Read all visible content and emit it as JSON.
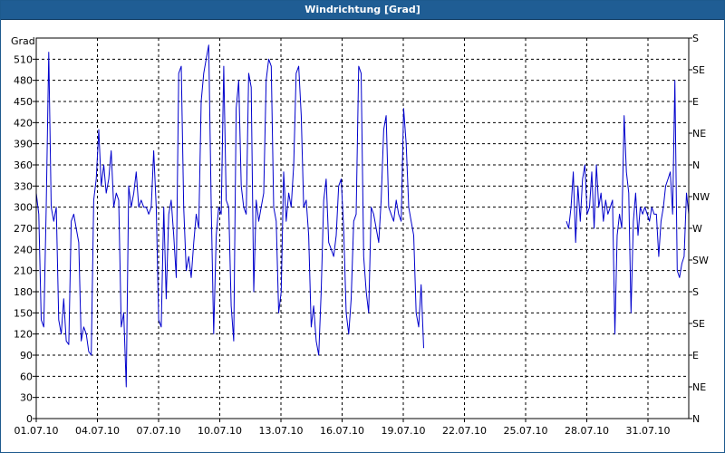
{
  "window": {
    "title": "Windrichtung [Grad]"
  },
  "colors": {
    "title_bar": "#1f5d94",
    "series": "#0000cc",
    "grid": "#000000"
  },
  "chart_data": {
    "type": "line",
    "title": "Windrichtung [Grad]",
    "ylabel": "Grad",
    "xlabel": "",
    "ylim": [
      0,
      540
    ],
    "xlim": [
      "2010-07-01",
      "2010-08-02"
    ],
    "y_ticks": [
      0,
      30,
      60,
      90,
      120,
      150,
      180,
      210,
      240,
      270,
      300,
      330,
      360,
      390,
      420,
      450,
      480,
      510
    ],
    "x_ticks": [
      "01.07.10",
      "04.07.10",
      "07.07.10",
      "10.07.10",
      "13.07.10",
      "16.07.10",
      "19.07.10",
      "22.07.10",
      "25.07.10",
      "28.07.10",
      "31.07.10"
    ],
    "right_axis": {
      "ticks": [
        0,
        45,
        90,
        135,
        180,
        225,
        270,
        315,
        360,
        405,
        450,
        495,
        540
      ],
      "labels": [
        "N",
        "NE",
        "E",
        "SE",
        "S",
        "SW",
        "W",
        "NW",
        "N",
        "NE",
        "E",
        "SE",
        "S"
      ]
    },
    "grid": true,
    "series": [
      {
        "segments": [
          {
            "x_start": "2010-07-01",
            "x_end": "2010-07-20",
            "values": [
              320,
              290,
              140,
              130,
              300,
              520,
              300,
              280,
              300,
              140,
              120,
              170,
              110,
              105,
              280,
              290,
              270,
              250,
              110,
              130,
              120,
              95,
              90,
              310,
              340,
              410,
              330,
              360,
              320,
              340,
              380,
              300,
              320,
              310,
              130,
              150,
              45,
              330,
              300,
              320,
              350,
              300,
              310,
              300,
              300,
              290,
              300,
              380,
              300,
              140,
              130,
              300,
              170,
              290,
              310,
              260,
              200,
              490,
              500,
              300,
              210,
              230,
              200,
              250,
              290,
              270,
              450,
              490,
              510,
              530,
              300,
              120,
              260,
              300,
              290,
              500,
              310,
              300,
              160,
              110,
              440,
              480,
              330,
              300,
              290,
              490,
              470,
              180,
              310,
              280,
              300,
              320,
              480,
              510,
              500,
              300,
              280,
              150,
              180,
              350,
              280,
              320,
              300,
              360,
              490,
              500,
              430,
              300,
              310,
              260,
              130,
              160,
              110,
              90,
              180,
              310,
              340,
              250,
              240,
              230,
              260,
              330,
              340,
              270,
              150,
              120,
              170,
              280,
              290,
              500,
              490,
              230,
              180,
              150,
              300,
              290,
              270,
              250,
              310,
              410,
              430,
              300,
              290,
              280,
              310,
              290,
              280,
              440,
              390,
              300,
              280,
              260,
              150,
              130,
              190,
              100
            ]
          },
          {
            "x_start": "2010-07-27",
            "x_end": "2010-08-02",
            "values": [
              280,
              270,
              300,
              350,
              250,
              330,
              280,
              340,
              360,
              290,
              300,
              350,
              270,
              360,
              300,
              320,
              280,
              310,
              290,
              300,
              310,
              120,
              260,
              290,
              270,
              430,
              350,
              320,
              150,
              280,
              320,
              260,
              300,
              290,
              300,
              290,
              280,
              300,
              290,
              290,
              230,
              280,
              300,
              330,
              340,
              350,
              290,
              480,
              210,
              200,
              220,
              230,
              320,
              290
            ]
          }
        ]
      }
    ]
  }
}
